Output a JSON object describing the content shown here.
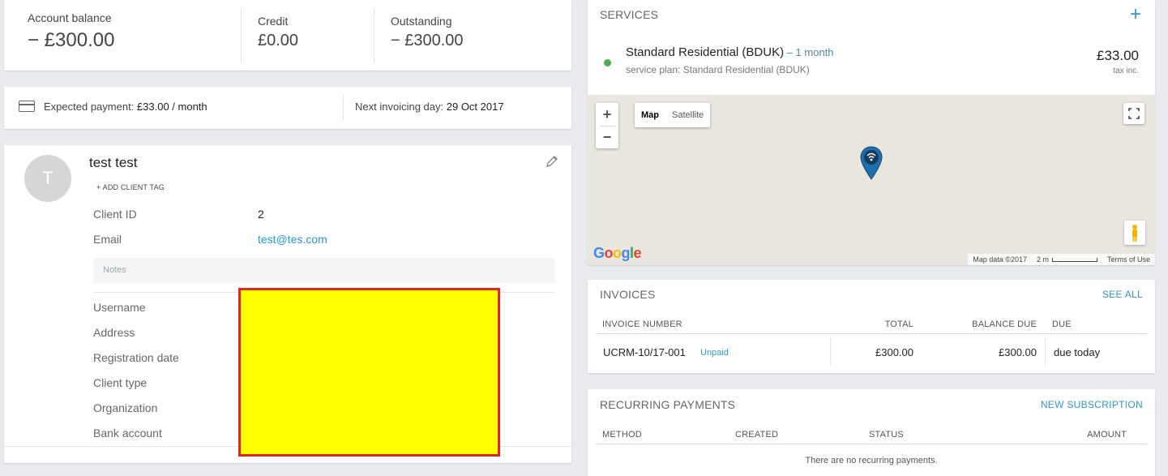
{
  "balance": {
    "account_label": "Account balance",
    "account_value": "− £300.00",
    "credit_label": "Credit",
    "credit_value": "£0.00",
    "outstanding_label": "Outstanding",
    "outstanding_value": "− £300.00"
  },
  "expected": {
    "payment_label": "Expected payment:",
    "payment_value": "£33.00 / month",
    "invoicing_label": "Next invoicing day:",
    "invoicing_value": "29 Oct 2017"
  },
  "client": {
    "avatar_initial": "T",
    "name": "test test",
    "add_tag_label": "+ ADD CLIENT TAG",
    "rows": [
      {
        "label": "Client ID",
        "value": "2"
      },
      {
        "label": "Email",
        "value": "test@tes.com"
      }
    ],
    "notes_placeholder": "Notes",
    "detail_labels": [
      "Username",
      "Address",
      "Registration date",
      "Client type",
      "Organization",
      "Bank account"
    ]
  },
  "services": {
    "title": "SERVICES",
    "add_icon": "plus-icon",
    "status_color": "#4caf50",
    "item": {
      "name": "Standard Residential (BDUK)",
      "period": " – 1 month",
      "plan": "service plan: Standard Residential (BDUK)",
      "price": "£33.00",
      "tax": "tax inc."
    },
    "map": {
      "zoom_in": "+",
      "zoom_out": "−",
      "type_map": "Map",
      "type_satellite": "Satellite",
      "logo": "Google",
      "data_credit": "Map data ©2017",
      "scale": "2 m",
      "terms": "Terms of Use"
    }
  },
  "invoices": {
    "title": "INVOICES",
    "see_all": "SEE ALL",
    "columns": [
      "INVOICE NUMBER",
      "TOTAL",
      "BALANCE DUE",
      "DUE"
    ],
    "rows": [
      {
        "number": "UCRM-10/17-001",
        "status": "Unpaid",
        "total": "£300.00",
        "balance": "£300.00",
        "due": "due today"
      }
    ]
  },
  "recurring": {
    "title": "RECURRING PAYMENTS",
    "new_subscription": "NEW SUBSCRIPTION",
    "columns": [
      "METHOD",
      "CREATED",
      "STATUS",
      "AMOUNT"
    ],
    "empty": "There are no recurring payments."
  },
  "colors": {
    "accent": "#2c96d3",
    "redaction_fill": "#ffff00",
    "redaction_border": "#e3261b"
  }
}
